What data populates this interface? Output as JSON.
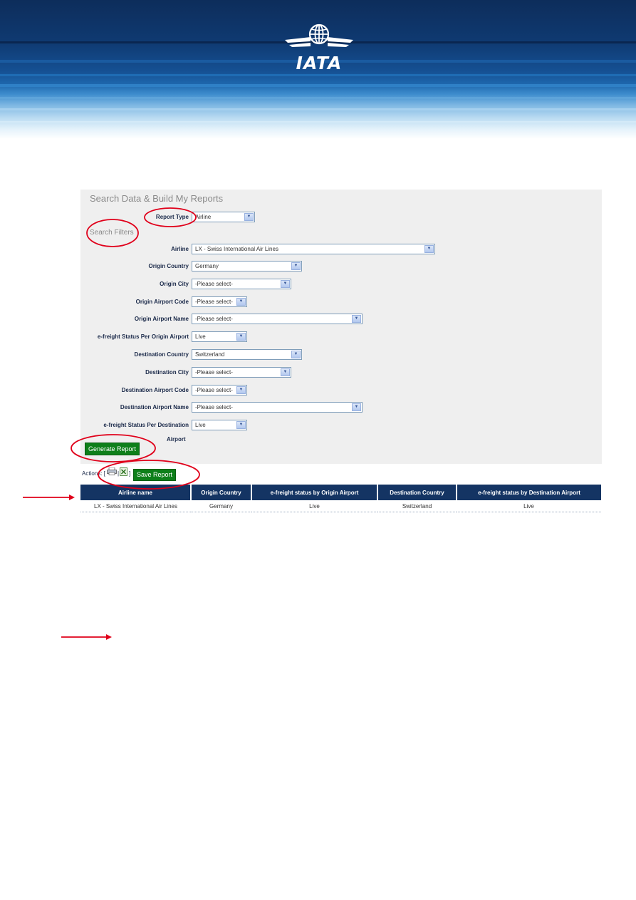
{
  "brand": {
    "logo_text": "IATA"
  },
  "panel": {
    "title": "Search Data & Build My Reports",
    "report_type_label": "Report Type",
    "report_type_value": "Airline",
    "filters_title": "Search Filters"
  },
  "filters": [
    {
      "label": "Airline",
      "value": "LX - Swiss International Air Lines"
    },
    {
      "label": "Origin Country",
      "value": "Germany"
    },
    {
      "label": "Origin City",
      "value": "-Please select-"
    },
    {
      "label": "Origin Airport Code",
      "value": "-Please select-"
    },
    {
      "label": "Origin Airport Name",
      "value": "-Please select-"
    },
    {
      "label": "e-freight Status Per Origin Airport",
      "value": "Live"
    },
    {
      "label": "Destination Country",
      "value": "Switzerland"
    },
    {
      "label": "Destination City",
      "value": "-Please select-"
    },
    {
      "label": "Destination Airport Code",
      "value": "-Please select-"
    },
    {
      "label": "Destination Airport Name",
      "value": "-Please select-"
    },
    {
      "label": "e-freight Status Per Destination",
      "value": "Live"
    }
  ],
  "filters_extra_label": "Airport",
  "buttons": {
    "generate": "Generate Report",
    "save": "Save Report"
  },
  "actions": {
    "label": "Actions: [",
    "sep": "|",
    "close": "]"
  },
  "table": {
    "headers": [
      "Airline name",
      "Origin Country",
      "e-freight status by Origin Airport",
      "Destination Country",
      "e-freight status by Destination Airport"
    ],
    "rows": [
      [
        "LX - Swiss International Air Lines",
        "Germany",
        "Live",
        "Switzerland",
        "Live"
      ]
    ]
  },
  "colors": {
    "header_navy": "#143463",
    "button_green": "#0e7f1a",
    "annotation_red": "#e0001a",
    "panel_bg": "#efefef"
  }
}
